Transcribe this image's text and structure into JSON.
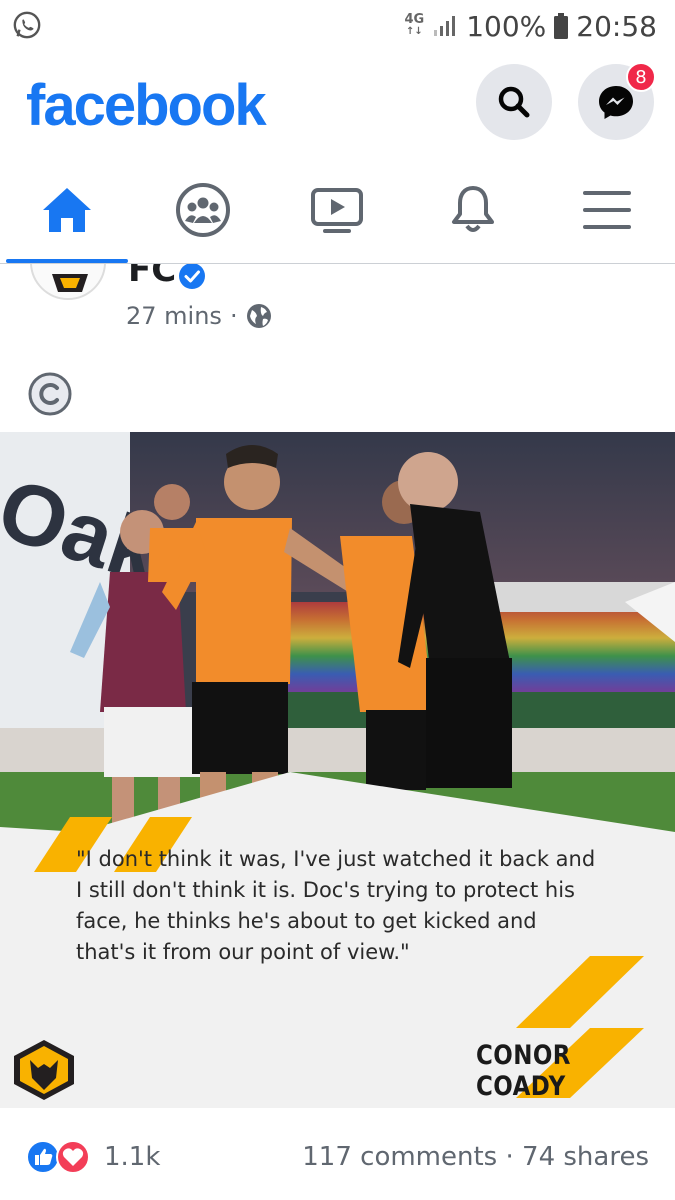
{
  "status_bar": {
    "network": "4G",
    "battery_percent": "100%",
    "time": "20:58"
  },
  "header": {
    "logo": "facebook",
    "messenger_badge": "8"
  },
  "nav": {
    "tabs": [
      {
        "name": "home",
        "icon": "home-icon",
        "active": true
      },
      {
        "name": "groups",
        "icon": "groups-icon",
        "active": false
      },
      {
        "name": "watch",
        "icon": "video-icon",
        "active": false
      },
      {
        "name": "notifications",
        "icon": "bell-icon",
        "active": false
      },
      {
        "name": "menu",
        "icon": "hamburger-icon",
        "active": false
      }
    ]
  },
  "post": {
    "page_name": "FC",
    "time": "27 mins",
    "separator": "·",
    "image": {
      "quote": "\"I don't think it was, I've just watched it back and I still don't think it is. Doc's trying to protect his face, he thinks he's about to get kicked and that's it from our point of view.\"",
      "player_name": "CONOR COADY"
    },
    "reactions_count": "1.1k",
    "comments_shares": "117 comments · 74 shares"
  },
  "colors": {
    "brand": "#1877f2",
    "badge": "#f02849",
    "wolves_gold": "#f9b200",
    "kit_orange": "#f28c2b"
  }
}
